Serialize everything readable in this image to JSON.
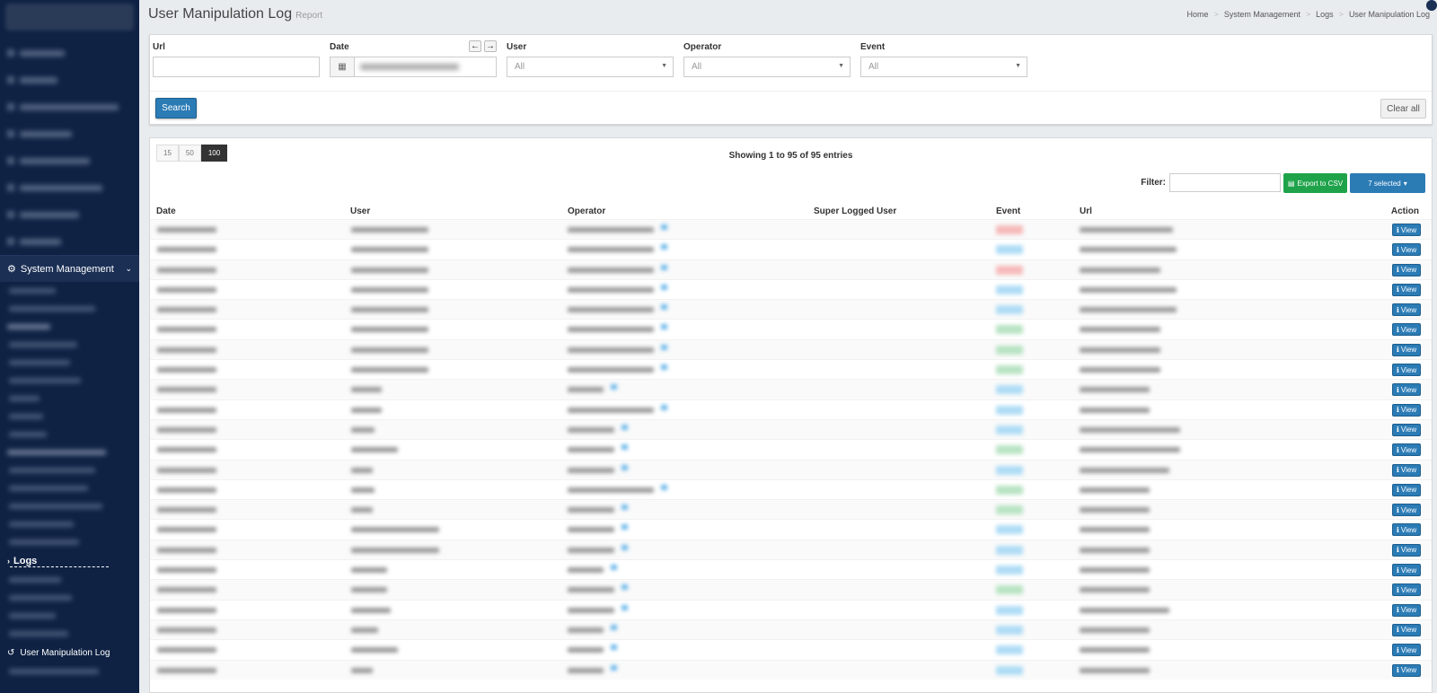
{
  "header": {
    "title": "User Manipulation Log",
    "subtitle": "Report",
    "breadcrumbs": [
      "Home",
      "System Management",
      "Logs",
      "User Manipulation Log"
    ]
  },
  "sidebar": {
    "section_label": "System Management",
    "logs_label": "Logs",
    "active_item_label": "User Manipulation Log"
  },
  "filters": {
    "url": {
      "label": "Url",
      "value": ""
    },
    "date": {
      "label": "Date"
    },
    "user": {
      "label": "User",
      "value": "All"
    },
    "operator": {
      "label": "Operator",
      "value": "All"
    },
    "event": {
      "label": "Event",
      "value": "All"
    },
    "search_label": "Search",
    "clear_label": "Clear all"
  },
  "table": {
    "page_sizes": [
      "15",
      "50",
      "100"
    ],
    "active_page_size": "100",
    "showing": "Showing 1 to 95 of 95 entries",
    "filter_label": "Filter:",
    "export_label": "Export to CSV",
    "columns_selected_label": "7 selected",
    "columns": [
      "Date",
      "User",
      "Operator",
      "Super Logged User",
      "Event",
      "Url",
      "Action"
    ],
    "view_label": "View",
    "row_events": [
      "red",
      "blue",
      "red",
      "blue",
      "blue",
      "green",
      "green",
      "green",
      "blue",
      "blue",
      "blue",
      "green",
      "blue",
      "green",
      "green",
      "blue",
      "blue",
      "blue",
      "green",
      "blue",
      "blue",
      "blue",
      "blue"
    ],
    "colors": {
      "red": "#f6b9b9",
      "blue": "#aedcf5",
      "green": "#b8e3c3"
    }
  }
}
